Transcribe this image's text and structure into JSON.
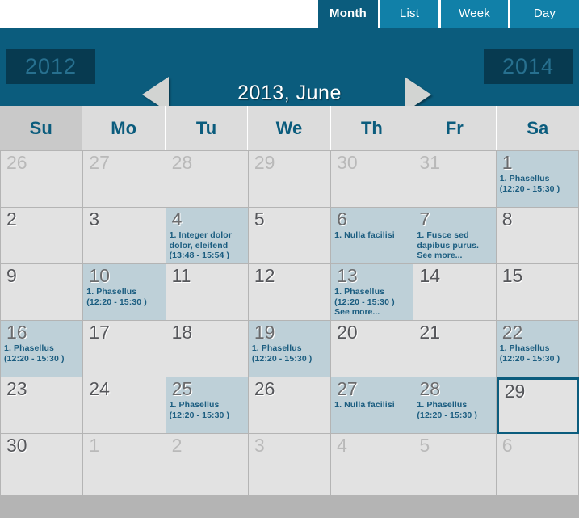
{
  "tabs": [
    {
      "label": "Month",
      "active": true
    },
    {
      "label": "List",
      "active": false
    },
    {
      "label": "Week",
      "active": false
    },
    {
      "label": "Day",
      "active": false
    }
  ],
  "header": {
    "title": "2013, June",
    "year_prev": "2012",
    "year_next": "2014",
    "prev_arrow_icon": "triangle-left-icon",
    "next_arrow_icon": "triangle-right-icon"
  },
  "weekdays": [
    "Su",
    "Mo",
    "Tu",
    "We",
    "Th",
    "Fr",
    "Sa"
  ],
  "colors": {
    "header_bg": "#0b5c7d",
    "tab_inactive_bg": "#1180a8",
    "tab_active_bg": "#0b5c7d",
    "year_btn_bg": "#073a50",
    "year_btn_text": "#27708f",
    "event_text": "#1b5d80",
    "event_day_bg": "#bed0d8",
    "day_bg": "#e2e2e2",
    "grid_line": "#b4b4b4",
    "weekday_bg": "#dcdcdc",
    "sunday_header_bg": "#c9c9c9",
    "selected_border": "#0b5c7d"
  },
  "weeks": [
    [
      {
        "day": "26",
        "month": "other",
        "events": []
      },
      {
        "day": "27",
        "month": "other",
        "events": []
      },
      {
        "day": "28",
        "month": "other",
        "events": []
      },
      {
        "day": "29",
        "month": "other",
        "events": []
      },
      {
        "day": "30",
        "month": "other",
        "events": []
      },
      {
        "day": "31",
        "month": "other",
        "events": []
      },
      {
        "day": "1",
        "month": "current",
        "events": [
          {
            "title": "1.  Phasellus",
            "time": "(12:20 - 15:30 )"
          }
        ],
        "more": null
      }
    ],
    [
      {
        "day": "2",
        "month": "current",
        "events": []
      },
      {
        "day": "3",
        "month": "current",
        "events": []
      },
      {
        "day": "4",
        "month": "current",
        "events": [
          {
            "title": "1.  Integer dolor",
            "title2": "dolor, eleifend",
            "time": "(13:48 - 15:54 )"
          }
        ],
        "more": "See more..."
      },
      {
        "day": "5",
        "month": "current",
        "events": []
      },
      {
        "day": "6",
        "month": "current",
        "events": [
          {
            "title": "1.  Nulla facilisi",
            "time": ""
          }
        ],
        "more": null
      },
      {
        "day": "7",
        "month": "current",
        "events": [
          {
            "title": "1.  Fusce sed",
            "title2": "dapibus purus.",
            "time": ""
          }
        ],
        "more": "See more..."
      },
      {
        "day": "8",
        "month": "current",
        "events": []
      }
    ],
    [
      {
        "day": "9",
        "month": "current",
        "events": []
      },
      {
        "day": "10",
        "month": "current",
        "events": [
          {
            "title": "1.  Phasellus",
            "time": "(12:20 - 15:30 )"
          }
        ],
        "more": null
      },
      {
        "day": "11",
        "month": "current",
        "events": []
      },
      {
        "day": "12",
        "month": "current",
        "events": []
      },
      {
        "day": "13",
        "month": "current",
        "events": [
          {
            "title": "1.  Phasellus",
            "time": "(12:20 - 15:30 )"
          }
        ],
        "more": "See more..."
      },
      {
        "day": "14",
        "month": "current",
        "events": []
      },
      {
        "day": "15",
        "month": "current",
        "events": []
      }
    ],
    [
      {
        "day": "16",
        "month": "current",
        "events": [
          {
            "title": "1.  Phasellus",
            "time": "(12:20 - 15:30 )"
          }
        ],
        "more": null
      },
      {
        "day": "17",
        "month": "current",
        "events": []
      },
      {
        "day": "18",
        "month": "current",
        "events": []
      },
      {
        "day": "19",
        "month": "current",
        "events": [
          {
            "title": "1.  Phasellus",
            "time": "(12:20 - 15:30 )"
          }
        ],
        "more": null
      },
      {
        "day": "20",
        "month": "current",
        "events": []
      },
      {
        "day": "21",
        "month": "current",
        "events": []
      },
      {
        "day": "22",
        "month": "current",
        "events": [
          {
            "title": "1.  Phasellus",
            "time": "(12:20 - 15:30 )"
          }
        ],
        "more": null
      }
    ],
    [
      {
        "day": "23",
        "month": "current",
        "events": []
      },
      {
        "day": "24",
        "month": "current",
        "events": []
      },
      {
        "day": "25",
        "month": "current",
        "events": [
          {
            "title": "1.  Phasellus",
            "time": "(12:20 - 15:30 )"
          }
        ],
        "more": null
      },
      {
        "day": "26",
        "month": "current",
        "events": []
      },
      {
        "day": "27",
        "month": "current",
        "events": [
          {
            "title": "1.  Nulla facilisi",
            "time": ""
          }
        ],
        "more": null
      },
      {
        "day": "28",
        "month": "current",
        "events": [
          {
            "title": "1.  Phasellus",
            "time": "(12:20 - 15:30 )"
          }
        ],
        "more": null
      },
      {
        "day": "29",
        "month": "current",
        "events": [],
        "selected": true
      }
    ],
    [
      {
        "day": "30",
        "month": "current",
        "events": []
      },
      {
        "day": "1",
        "month": "other",
        "events": []
      },
      {
        "day": "2",
        "month": "other",
        "events": []
      },
      {
        "day": "3",
        "month": "other",
        "events": []
      },
      {
        "day": "4",
        "month": "other",
        "events": []
      },
      {
        "day": "5",
        "month": "other",
        "events": []
      },
      {
        "day": "6",
        "month": "other",
        "events": []
      }
    ]
  ]
}
